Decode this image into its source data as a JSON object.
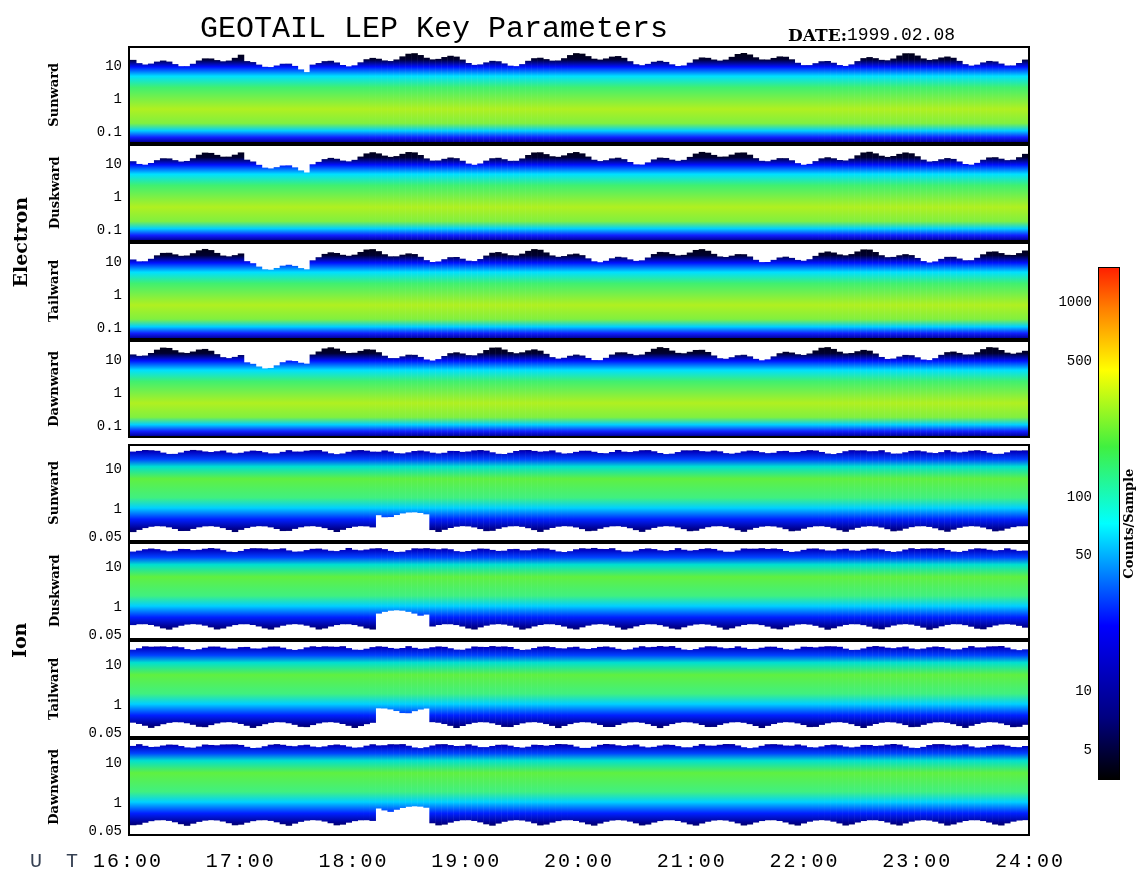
{
  "title": "GEOTAIL LEP Key Parameters",
  "date_label": "DATE:",
  "date": "1999.02.08",
  "groups": [
    {
      "kind": "electron",
      "name": "Electron",
      "panels": [
        {
          "label": "Sunward",
          "yticks": [
            "10",
            "1",
            "0.1"
          ]
        },
        {
          "label": "Duskward",
          "yticks": [
            "10",
            "1",
            "0.1"
          ]
        },
        {
          "label": "Tailward",
          "yticks": [
            "10",
            "1",
            "0.1"
          ]
        },
        {
          "label": "Dawnward",
          "yticks": [
            "10",
            "1",
            "0.1"
          ]
        }
      ]
    },
    {
      "kind": "ion",
      "name": "Ion",
      "panels": [
        {
          "label": "Sunward",
          "yticks": [
            "10",
            "1",
            "0.05"
          ]
        },
        {
          "label": "Duskward",
          "yticks": [
            "10",
            "1",
            "0.05"
          ]
        },
        {
          "label": "Tailward",
          "yticks": [
            "10",
            "1",
            "0.05"
          ]
        },
        {
          "label": "Dawnward",
          "yticks": [
            "10",
            "1",
            "0.05"
          ]
        }
      ]
    }
  ],
  "x_axis": {
    "label": "U T",
    "ticks": [
      "16:00",
      "17:00",
      "18:00",
      "19:00",
      "20:00",
      "21:00",
      "22:00",
      "23:00",
      "24:00"
    ]
  },
  "colorbar": {
    "label": "Counts/Sample",
    "ticks": [
      "1000",
      "500",
      "100",
      "50",
      "10",
      "5"
    ]
  }
}
